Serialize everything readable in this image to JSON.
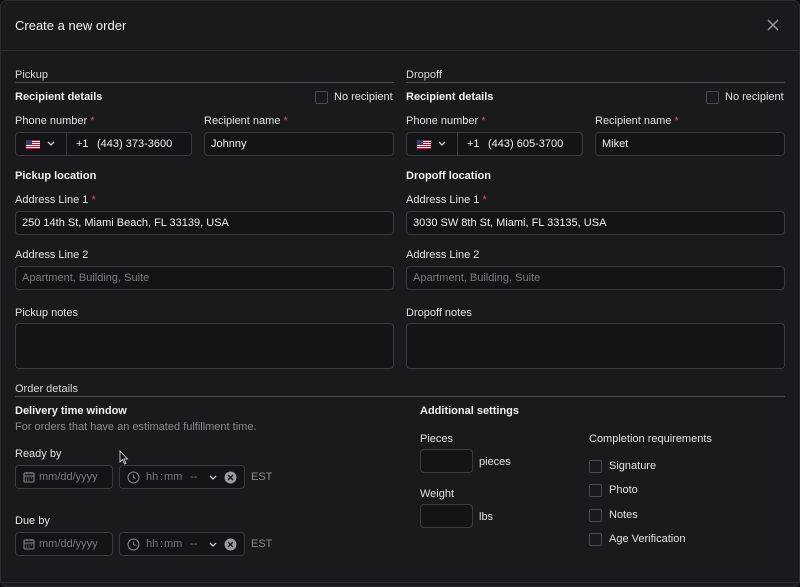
{
  "modal": {
    "title": "Create a new order"
  },
  "pickup": {
    "section": "Pickup",
    "recipient_title": "Recipient details",
    "no_recipient": "No recipient",
    "phone_label": "Phone number",
    "phone_code": "+1",
    "phone_value": "(443) 373-3600",
    "name_label": "Recipient name",
    "name_value": "Johnny",
    "location_title": "Pickup location",
    "addr1_label": "Address Line 1",
    "addr1_value": "250 14th St, Miami Beach, FL 33139, USA",
    "addr2_label": "Address Line 2",
    "addr2_placeholder": "Apartment, Building, Suite",
    "notes_label": "Pickup notes"
  },
  "dropoff": {
    "section": "Dropoff",
    "recipient_title": "Recipient details",
    "no_recipient": "No recipient",
    "phone_label": "Phone number",
    "phone_code": "+1",
    "phone_value": "(443) 605-3700",
    "name_label": "Recipient name",
    "name_value": "Miket",
    "location_title": "Dropoff location",
    "addr1_label": "Address Line 1",
    "addr1_value": "3030 SW 8th St, Miami, FL 33135, USA",
    "addr2_label": "Address Line 2",
    "addr2_placeholder": "Apartment, Building, Suite",
    "notes_label": "Dropoff notes"
  },
  "order": {
    "section": "Order details",
    "window_title": "Delivery time window",
    "window_sub": "For orders that have an estimated fulfillment time.",
    "ready_label": "Ready by",
    "due_label": "Due by",
    "date_placeholder": "mm/dd/yyyy",
    "time_placeholder_h": "hh",
    "time_sep": ":",
    "time_placeholder_m": "mm",
    "ampm_placeholder": "--",
    "timezone": "EST"
  },
  "settings": {
    "title": "Additional settings",
    "pieces_label": "Pieces",
    "pieces_unit": "pieces",
    "weight_label": "Weight",
    "weight_unit": "lbs",
    "completion_title": "Completion requirements",
    "requirements": [
      "Signature",
      "Photo",
      "Notes",
      "Age Verification"
    ]
  },
  "required_mark": "*",
  "colors": {
    "background": "#1a1a1c",
    "border": "#3a3a3f",
    "required": "#e05555"
  }
}
